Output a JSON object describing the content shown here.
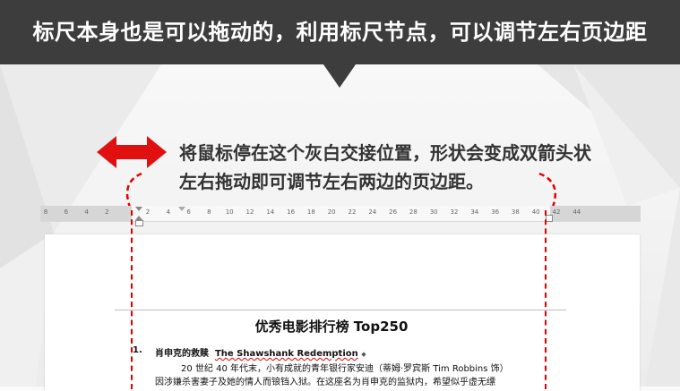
{
  "banner": {
    "text": "标尺本身也是可以拖动的，利用标尺节点，可以调节左右页边距"
  },
  "callout": {
    "line1": "将鼠标停在这个灰白交接位置，形状会变成双箭头状",
    "line2": "左右拖动即可调节左右两边的页边距。",
    "arrow_color": "#e01010"
  },
  "ruler": {
    "labels": [
      "8",
      "6",
      "4",
      "2",
      "",
      "2",
      "4",
      "6",
      "8",
      "10",
      "12",
      "14",
      "16",
      "18",
      "20",
      "22",
      "24",
      "26",
      "28",
      "30",
      "32",
      "34",
      "36",
      "38",
      "40",
      "42",
      "44"
    ]
  },
  "document": {
    "title": "优秀电影排行榜 Top250",
    "item": {
      "number": "1.",
      "title_cn": "肖申克的救赎",
      "title_en": "The Shawshank Redemption"
    },
    "para_line1": "20 世纪 40 年代末，小有成就的青年银行家安迪（蒂姆·罗宾斯 Tim Robbins 饰）",
    "para_line2": "因涉嫌杀害妻子及她的情人而锒铛入狱。在这座名为肖申克的监狱内，希望似乎虚无缥"
  },
  "colors": {
    "banner_bg": "#3d3d3d",
    "accent_red": "#e00000"
  }
}
